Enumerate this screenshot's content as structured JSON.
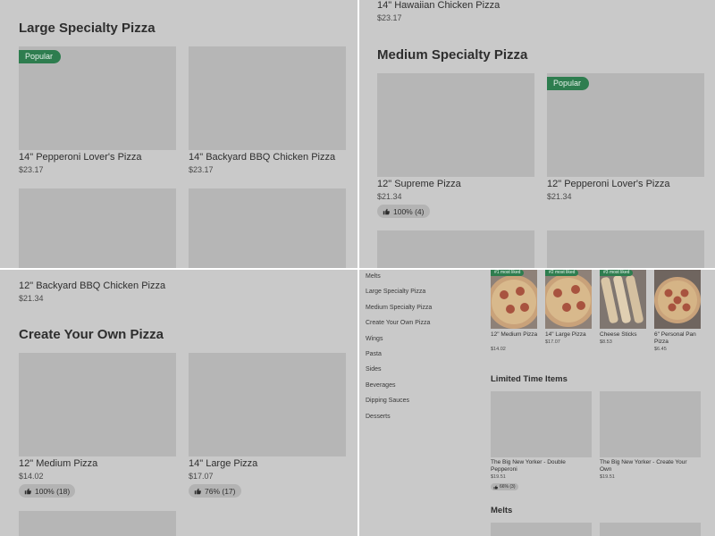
{
  "q1": {
    "section_title": "Large Specialty Pizza",
    "popular_badge": "Popular",
    "items": [
      {
        "name": "14\" Pepperoni Lover's Pizza",
        "price": "$23.17"
      },
      {
        "name": "14\" Backyard BBQ Chicken Pizza",
        "price": "$23.17"
      }
    ]
  },
  "q2": {
    "top_item": {
      "name": "14\" Hawaiian Chicken Pizza",
      "price": "$23.17"
    },
    "section_title": "Medium Specialty Pizza",
    "popular_badge": "Popular",
    "items": [
      {
        "name": "12\" Supreme Pizza",
        "price": "$21.34",
        "rating": "100% (4)"
      },
      {
        "name": "12\" Pepperoni Lover's Pizza",
        "price": "$21.34"
      }
    ]
  },
  "q3": {
    "top_item": {
      "name": "12\" Backyard BBQ Chicken Pizza",
      "price": "$21.34"
    },
    "section_title": "Create Your Own Pizza",
    "items": [
      {
        "name": "12\" Medium Pizza",
        "price": "$14.02",
        "rating": "100% (18)"
      },
      {
        "name": "14\" Large Pizza",
        "price": "$17.07",
        "rating": "76% (17)"
      }
    ]
  },
  "q4": {
    "nav": [
      "Melts",
      "Large Specialty Pizza",
      "Medium Specialty Pizza",
      "Create Your Own Pizza",
      "Wings",
      "Pasta",
      "Sides",
      "Beverages",
      "Dipping Sauces",
      "Desserts"
    ],
    "most_liked": [
      {
        "badge": "#1 most liked",
        "name": "12\" Medium Pizza",
        "price": "$14.02"
      },
      {
        "badge": "#2 most liked",
        "name": "14\" Large Pizza",
        "price": "$17.07"
      },
      {
        "badge": "#3 most liked",
        "name": "Cheese Sticks",
        "price": "$8.53"
      },
      {
        "badge": "",
        "name": "6\" Personal Pan Pizza",
        "price": "$6.45"
      }
    ],
    "limited_title": "Limited Time Items",
    "limited_items": [
      {
        "name": "The Big New Yorker - Double Pepperoni",
        "price": "$19.51",
        "rating": "66% (3)"
      },
      {
        "name": "The Big New Yorker - Create Your Own",
        "price": "$19.51"
      }
    ],
    "melts_title": "Melts"
  },
  "colors": {
    "background_overlay": "#c9c9c9",
    "badge_green": "#2e7d4f",
    "divider": "#ffffff"
  },
  "icons": {
    "rating": "thumbs-up-icon"
  }
}
